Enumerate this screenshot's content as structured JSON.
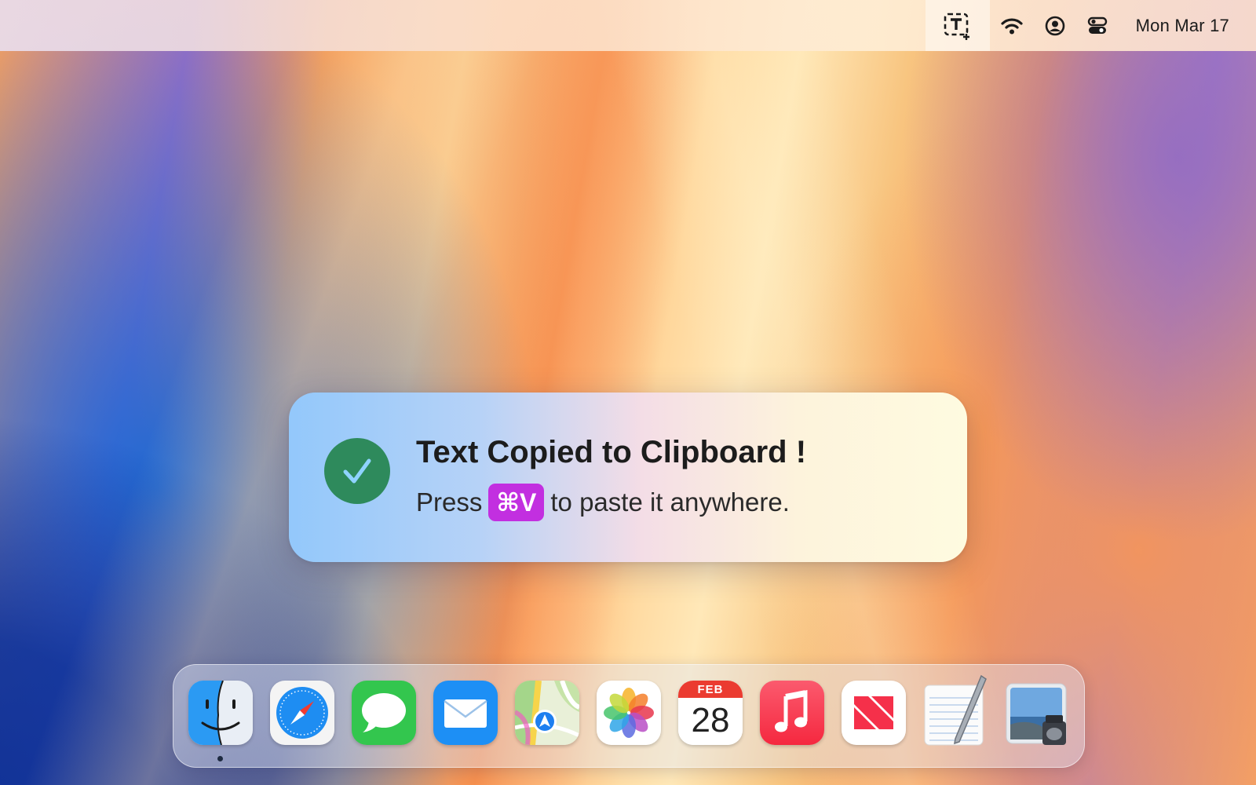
{
  "menubar": {
    "clock": "Mon Mar 17",
    "icons": [
      "text-capture-icon",
      "wifi-icon",
      "user-account-icon",
      "control-center-icon"
    ]
  },
  "toast": {
    "title": "Text Copied to Clipboard !",
    "prefix": "Press",
    "shortcut": "⌘V",
    "suffix": "to paste it anywhere.",
    "colors": {
      "check": "#2e8a5c",
      "shortcut_bg": "#c22fe0"
    }
  },
  "dock": {
    "apps": [
      {
        "name": "Finder",
        "icon": "finder-icon",
        "running": true
      },
      {
        "name": "Safari",
        "icon": "safari-icon",
        "running": false
      },
      {
        "name": "Messages",
        "icon": "messages-icon",
        "running": false
      },
      {
        "name": "Mail",
        "icon": "mail-icon",
        "running": false
      },
      {
        "name": "Maps",
        "icon": "maps-icon",
        "running": false
      },
      {
        "name": "Photos",
        "icon": "photos-icon",
        "running": false
      },
      {
        "name": "Calendar",
        "icon": "calendar-icon",
        "running": false
      },
      {
        "name": "Music",
        "icon": "music-icon",
        "running": false
      },
      {
        "name": "News",
        "icon": "news-icon",
        "running": false
      },
      {
        "name": "TextEdit",
        "icon": "textedit-icon",
        "running": false
      },
      {
        "name": "Preview",
        "icon": "preview-icon",
        "running": false
      }
    ],
    "calendar": {
      "month": "FEB",
      "day": "28"
    }
  }
}
